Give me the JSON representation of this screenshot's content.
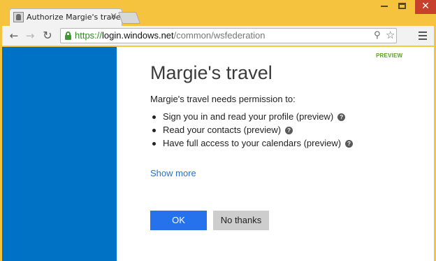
{
  "browser": {
    "tab_title": "Authorize Margie's travel",
    "tab_close": "×",
    "window_close": "✕",
    "url_scheme": "https://",
    "url_host": "login.windows.net",
    "url_path": "/common/wsfederation"
  },
  "page": {
    "preview_tag": "PREVIEW",
    "app_title": "Margie's travel",
    "intro": "Margie's travel needs permission to:",
    "permissions": [
      {
        "label": "Sign you in and read your profile (preview)"
      },
      {
        "label": "Read your contacts (preview)"
      },
      {
        "label": "Have full access to your calendars (preview)"
      }
    ],
    "help_glyph": "?",
    "show_more": "Show more",
    "ok_label": "OK",
    "no_thanks_label": "No thanks"
  },
  "colors": {
    "sidebar": "#0072c6",
    "ok_button": "#2672ec",
    "preview": "#5ba31a",
    "link": "#2a6fd6",
    "window_frame": "#f6c33e"
  },
  "icons": {
    "back": "back-arrow-icon",
    "forward": "forward-arrow-icon",
    "reload": "reload-icon",
    "lock": "lock-icon",
    "zoom": "zoom-icon",
    "star": "star-icon",
    "menu": "menu-icon",
    "help": "help-icon"
  }
}
